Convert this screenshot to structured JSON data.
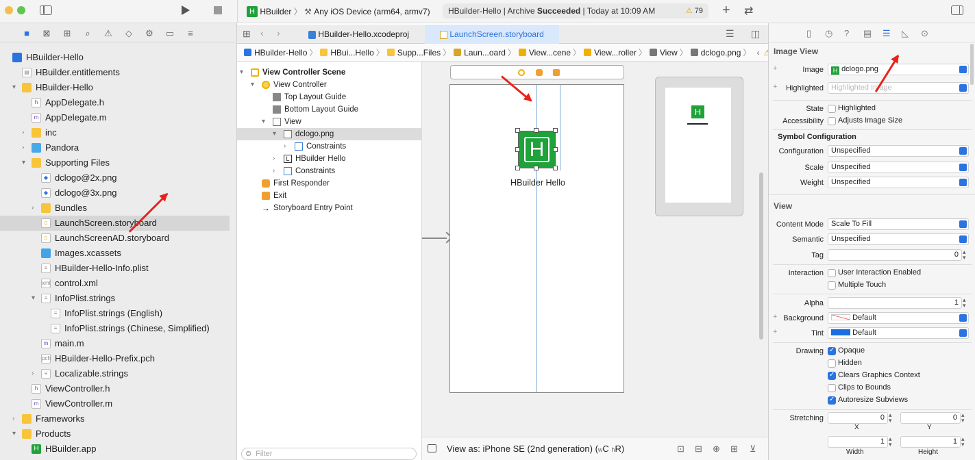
{
  "toolbar": {
    "scheme": "HBuilder",
    "device": "Any iOS Device (arm64, armv7)",
    "status_prefix": "HBuilder-Hello | Archive ",
    "status_bold": "Succeeded",
    "status_time": " | Today at 10:09 AM",
    "warning_count": "79"
  },
  "tabs": [
    "HBuilder-Hello.xcodeproj",
    "LaunchScreen.storyboard"
  ],
  "jumpbar": [
    "HBuilder-Hello",
    "HBui...Hello",
    "Supp...Files",
    "Laun...oard",
    "View...cene",
    "View...roller",
    "View",
    "dclogo.png"
  ],
  "navigator": [
    {
      "label": "HBuilder-Hello",
      "indent": 0,
      "icon": "blue",
      "disclosure": ""
    },
    {
      "label": "HBuilder.entitlements",
      "indent": 1,
      "icon": "file",
      "disclosure": ""
    },
    {
      "label": "HBuilder-Hello",
      "indent": 1,
      "icon": "folder",
      "disclosure": "▾"
    },
    {
      "label": "AppDelegate.h",
      "indent": 2,
      "icon": "h",
      "disclosure": ""
    },
    {
      "label": "AppDelegate.m",
      "indent": 2,
      "icon": "m",
      "disclosure": ""
    },
    {
      "label": "inc",
      "indent": 2,
      "icon": "folder",
      "disclosure": "›"
    },
    {
      "label": "Pandora",
      "indent": 2,
      "icon": "folder-blue",
      "disclosure": "›"
    },
    {
      "label": "Supporting Files",
      "indent": 2,
      "icon": "folder",
      "disclosure": "▾"
    },
    {
      "label": "dclogo@2x.png",
      "indent": 3,
      "icon": "png",
      "disclosure": ""
    },
    {
      "label": "dclogo@3x.png",
      "indent": 3,
      "icon": "png",
      "disclosure": ""
    },
    {
      "label": "Bundles",
      "indent": 3,
      "icon": "folder",
      "disclosure": "›"
    },
    {
      "label": "LaunchScreen.storyboard",
      "indent": 3,
      "icon": "storyboard",
      "disclosure": "",
      "selected": true
    },
    {
      "label": "LaunchScreenAD.storyboard",
      "indent": 3,
      "icon": "storyboard",
      "disclosure": ""
    },
    {
      "label": "Images.xcassets",
      "indent": 3,
      "icon": "assets",
      "disclosure": ""
    },
    {
      "label": "HBuilder-Hello-Info.plist",
      "indent": 3,
      "icon": "plist",
      "disclosure": ""
    },
    {
      "label": "control.xml",
      "indent": 3,
      "icon": "xml",
      "disclosure": ""
    },
    {
      "label": "InfoPlist.strings",
      "indent": 3,
      "icon": "strings",
      "disclosure": "▾"
    },
    {
      "label": "InfoPlist.strings (English)",
      "indent": 4,
      "icon": "strings",
      "disclosure": ""
    },
    {
      "label": "InfoPlist.strings (Chinese, Simplified)",
      "indent": 4,
      "icon": "strings",
      "disclosure": ""
    },
    {
      "label": "main.m",
      "indent": 3,
      "icon": "m",
      "disclosure": ""
    },
    {
      "label": "HBuilder-Hello-Prefix.pch",
      "indent": 3,
      "icon": "pch",
      "disclosure": ""
    },
    {
      "label": "Localizable.strings",
      "indent": 3,
      "icon": "strings",
      "disclosure": "›"
    },
    {
      "label": "ViewController.h",
      "indent": 2,
      "icon": "h",
      "disclosure": ""
    },
    {
      "label": "ViewController.m",
      "indent": 2,
      "icon": "m",
      "disclosure": ""
    },
    {
      "label": "Frameworks",
      "indent": 1,
      "icon": "folder",
      "disclosure": "›"
    },
    {
      "label": "Products",
      "indent": 1,
      "icon": "folder",
      "disclosure": "▾"
    },
    {
      "label": "HBuilder.app",
      "indent": 2,
      "icon": "app",
      "disclosure": ""
    }
  ],
  "outline": [
    {
      "label": "View Controller Scene",
      "indent": 0,
      "disclosure": "▾",
      "icon": "scene",
      "bold": true
    },
    {
      "label": "View Controller",
      "indent": 1,
      "disclosure": "▾",
      "icon": "vc"
    },
    {
      "label": "Top Layout Guide",
      "indent": 2,
      "disclosure": "",
      "icon": "guide"
    },
    {
      "label": "Bottom Layout Guide",
      "indent": 2,
      "disclosure": "",
      "icon": "guide"
    },
    {
      "label": "View",
      "indent": 2,
      "disclosure": "▾",
      "icon": "view"
    },
    {
      "label": "dclogo.png",
      "indent": 3,
      "disclosure": "▾",
      "icon": "image",
      "selected": true
    },
    {
      "label": "Constraints",
      "indent": 4,
      "disclosure": "›",
      "icon": "constraints"
    },
    {
      "label": "HBuilder Hello",
      "indent": 3,
      "disclosure": "›",
      "icon": "label"
    },
    {
      "label": "Constraints",
      "indent": 3,
      "disclosure": "›",
      "icon": "constraints"
    },
    {
      "label": "First Responder",
      "indent": 1,
      "disclosure": "",
      "icon": "responder"
    },
    {
      "label": "Exit",
      "indent": 1,
      "disclosure": "",
      "icon": "exit"
    },
    {
      "label": "Storyboard Entry Point",
      "indent": 1,
      "disclosure": "",
      "icon": "entry"
    }
  ],
  "canvas": {
    "logo_letter": "H",
    "label_text": "HBuilder Hello"
  },
  "filter_placeholder": "Filter",
  "view_as": {
    "prefix": "View as: iPhone SE (2nd generation) (",
    "w": "w",
    "c": "C",
    "h": "h",
    "r": "R",
    ")": ")"
  },
  "inspector": {
    "image_view_title": "Image View",
    "image_label": "Image",
    "image_value": "dclogo.png",
    "highlighted_label": "Highlighted",
    "highlighted_placeholder": "Highlighted Image",
    "state_label": "State",
    "state_option": "Highlighted",
    "accessibility_label": "Accessibility",
    "accessibility_option": "Adjusts Image Size",
    "symbol_title": "Symbol Configuration",
    "configuration_label": "Configuration",
    "configuration_value": "Unspecified",
    "scale_label": "Scale",
    "scale_value": "Unspecified",
    "weight_label": "Weight",
    "weight_value": "Unspecified",
    "view_title": "View",
    "content_mode_label": "Content Mode",
    "content_mode_value": "Scale To Fill",
    "semantic_label": "Semantic",
    "semantic_value": "Unspecified",
    "tag_label": "Tag",
    "tag_value": "0",
    "interaction_label": "Interaction",
    "user_interaction": "User Interaction Enabled",
    "multiple_touch": "Multiple Touch",
    "alpha_label": "Alpha",
    "alpha_value": "1",
    "background_label": "Background",
    "background_value": "Default",
    "tint_label": "Tint",
    "tint_value": "Default",
    "drawing_label": "Drawing",
    "opaque": "Opaque",
    "hidden": "Hidden",
    "clears_graphics": "Clears Graphics Context",
    "clips_bounds": "Clips to Bounds",
    "autoresize": "Autoresize Subviews",
    "stretching_label": "Stretching",
    "stretch_x": "0",
    "stretch_y": "0",
    "x_label": "X",
    "y_label": "Y",
    "stretch_w": "1",
    "stretch_h": "1",
    "width_label": "Width",
    "height_label": "Height"
  },
  "colors": {
    "accent": "#2a73e0",
    "logo_green": "#1fa23a",
    "arrow_red": "#e8221a"
  }
}
